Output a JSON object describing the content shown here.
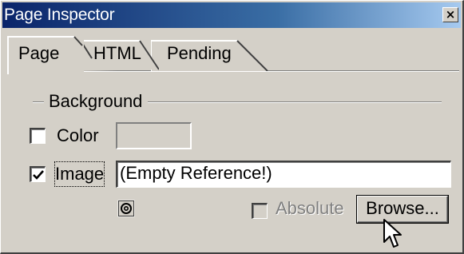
{
  "window": {
    "title": "Page Inspector",
    "close_glyph": "×"
  },
  "tabs": [
    {
      "label": "Page",
      "selected": true
    },
    {
      "label": "HTML",
      "selected": false
    },
    {
      "label": "Pending",
      "selected": false
    }
  ],
  "background_group": {
    "label": "Background",
    "color": {
      "label": "Color",
      "checked": false,
      "value": ""
    },
    "image": {
      "label": "Image",
      "checked": true,
      "value": "(Empty Reference!)"
    },
    "absolute": {
      "label": "Absolute",
      "checked": false,
      "enabled": false
    },
    "browse_button": "Browse...",
    "point_icon": "point-and-shoot-icon"
  },
  "colors": {
    "titlebar_start": "#0a246a",
    "titlebar_end": "#a6caf0",
    "face": "#d4d0c8"
  }
}
